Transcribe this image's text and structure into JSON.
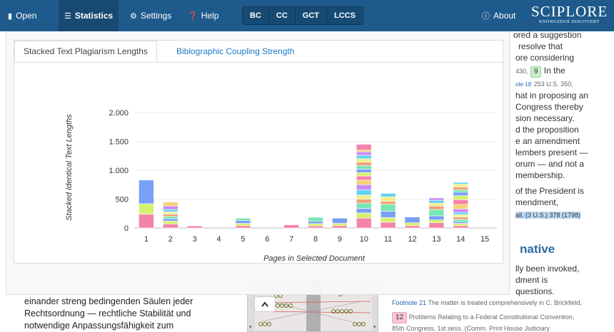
{
  "navbar": {
    "open": "Open",
    "statistics": "Statistics",
    "settings": "Settings",
    "help": "Help",
    "algorithms": [
      "BC",
      "CC",
      "GCT",
      "LCCS"
    ],
    "about": "About",
    "brand": "SCIPLORE",
    "brand_sub": "KNOWLEDGE DISCOVERY"
  },
  "panel": {
    "tabs": [
      "Stacked Text Plagiarism Lengths",
      "Biblographic Coupling Strength"
    ]
  },
  "right_doc": {
    "lines": [
      "ored a suggestion",
      "resolve that",
      "ore considering"
    ],
    "line4_pre": "430,",
    "badge9": "9",
    "line4_post": "In the",
    "fn18_label": "ote 18",
    "fn18_text": "253 U.S. 350,",
    "lines2": [
      "hat in proposing an",
      "Congress thereby",
      "sion necessary.",
      "d the proposition",
      "e an amendment",
      "lembers present —",
      "orum — and not a",
      "membership.",
      "of the President is",
      "mendment,"
    ],
    "citation": "all. (3 U.S.) 378 (1798)",
    "heading": "native",
    "lines3": [
      "lly been invoked,",
      "dment is",
      "questions."
    ],
    "fn21_label": "Footnote 21",
    "fn21_text": "The matter is treated comprehensively in C. Brickfield,",
    "badge12": "12",
    "fn21_text2": "Problems Relating to a Federal Constitutional Convention,",
    "fn21_text3": "85th Congress, 1st sess. (Comm. Print House Judiciary"
  },
  "left_doc": {
    "lines": [
      "einander streng bedingenden Säulen jeder",
      "Rechtsordnung — rechtliche Stabilität und",
      "notwendige Anpassungsfähigkeit zum"
    ]
  },
  "colors": {
    "navbar": "#1e5b8c",
    "link": "#1f7ac3"
  },
  "chart_data": {
    "type": "bar",
    "stacked": true,
    "xlabel": "Pages in Selected Document",
    "ylabel": "Stacked Identical Text Lengths",
    "ylim": [
      0,
      2000
    ],
    "yticks": [
      0,
      500,
      1000,
      1500,
      2000
    ],
    "ytick_labels": [
      "0",
      "500",
      "1.000",
      "1.500",
      "2.000"
    ],
    "categories": [
      "1",
      "2",
      "3",
      "4",
      "5",
      "6",
      "7",
      "8",
      "9",
      "10",
      "11",
      "12",
      "13",
      "14",
      "15"
    ],
    "palette": [
      "#f582a7",
      "#d6f06e",
      "#78a0f5",
      "#78e6b4",
      "#f0a078",
      "#f0f08c",
      "#64d2f0",
      "#c88cf0",
      "#f5d278"
    ],
    "stacks": [
      [
        240,
        180,
        410
      ],
      [
        70,
        50,
        40,
        40,
        40,
        40,
        40,
        60,
        70
      ],
      [
        35
      ],
      [],
      [
        40,
        40,
        50,
        40
      ],
      [],
      [
        55
      ],
      [
        35,
        40,
        40,
        70
      ],
      [
        40,
        40,
        90
      ],
      [
        170,
        90,
        80,
        90,
        70,
        70,
        90,
        90,
        80,
        70,
        60,
        60,
        60,
        60,
        60,
        60,
        60,
        30,
        100
      ],
      [
        100,
        80,
        110,
        120,
        50,
        80,
        60
      ],
      [
        40,
        50,
        100
      ],
      [
        90,
        50,
        70,
        110,
        60,
        50,
        50,
        40
      ],
      [
        40,
        40,
        30,
        40,
        40,
        40,
        40,
        60,
        80,
        80,
        70,
        60,
        40,
        50,
        50,
        30
      ]
    ]
  }
}
